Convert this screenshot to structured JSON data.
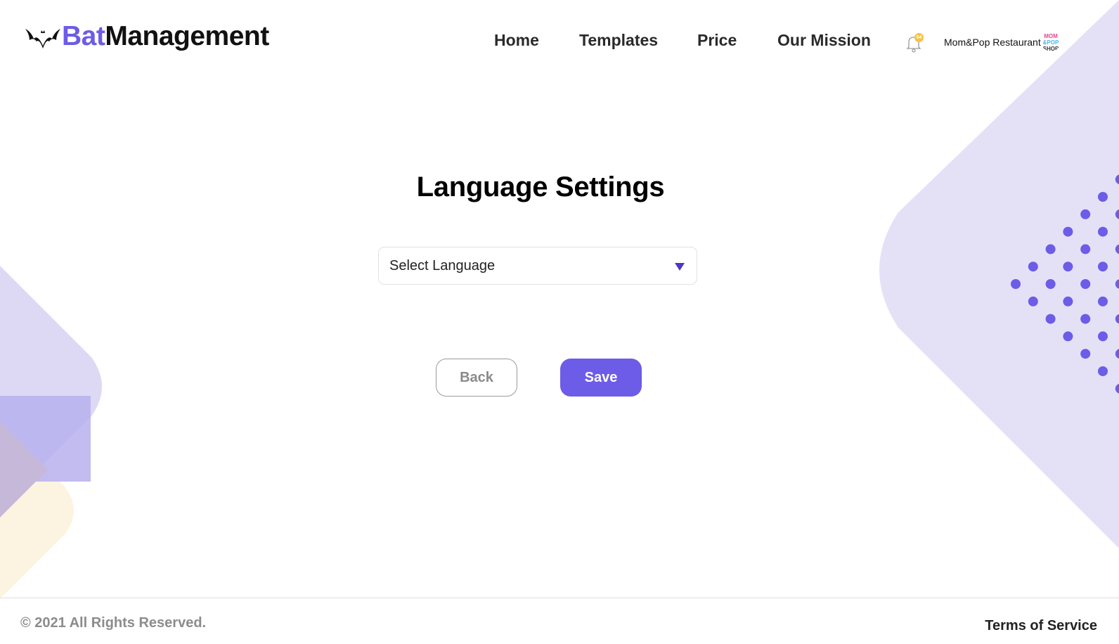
{
  "brand": {
    "part1": "Bat",
    "part2": "Management",
    "accent_color": "#6c5ce7",
    "logo_icon": "bat-icon"
  },
  "nav": {
    "items": [
      "Home",
      "Templates",
      "Price",
      "Our Mission"
    ]
  },
  "header": {
    "notification_icon": "bell-icon",
    "notification_count": "54",
    "account_name": "Mom&Pop Restaurant",
    "avatar_text": [
      "MOM",
      "&POP",
      "SHOP"
    ]
  },
  "main": {
    "title": "Language Settings",
    "language_select": {
      "placeholder": "Select Language",
      "icon": "dropdown-triangle-icon"
    },
    "back_label": "Back",
    "save_label": "Save"
  },
  "footer": {
    "copyright": "© 2021 All Rights Reserved.",
    "terms": "Terms of Service"
  },
  "colors": {
    "accent": "#6c5ce7",
    "lavender": "#e4e1f7",
    "peach": "#fdf3e1",
    "badge": "#f6c344"
  }
}
